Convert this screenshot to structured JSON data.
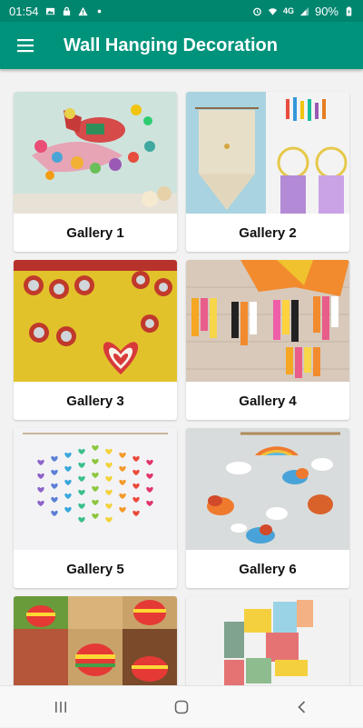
{
  "status_bar": {
    "time": "01:54",
    "network": "4G",
    "battery": "90%",
    "icons": [
      "gallery-icon",
      "lock-icon",
      "warning-icon",
      "dot-icon",
      "alarm-icon",
      "wifi-icon",
      "signal-icon",
      "battery-charging-icon"
    ]
  },
  "app_bar": {
    "title": "Wall Hanging Decoration",
    "menu_icon": "hamburger-menu-icon"
  },
  "galleries": [
    {
      "label": "Gallery 1"
    },
    {
      "label": "Gallery 2"
    },
    {
      "label": "Gallery 3"
    },
    {
      "label": "Gallery 4"
    },
    {
      "label": "Gallery 5"
    },
    {
      "label": "Gallery 6"
    },
    {
      "label": ""
    },
    {
      "label": ""
    }
  ],
  "nav_bar": {
    "icons": [
      "recent-apps-icon",
      "home-icon",
      "back-icon"
    ]
  },
  "colors": {
    "status_bar": "#00856f",
    "app_bar": "#00937b",
    "background": "#f2f2f2"
  }
}
